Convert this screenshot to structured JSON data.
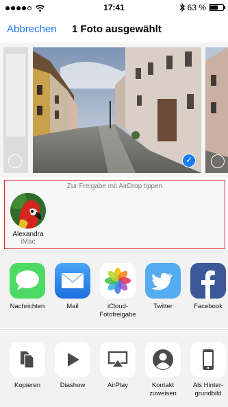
{
  "status_bar": {
    "time": "17:41",
    "battery_text": "63 %",
    "battery_level": 0.63,
    "signal_bars": 4
  },
  "nav": {
    "cancel_label": "Abbrechen",
    "title": "1 Foto ausgewählt"
  },
  "photos": {
    "selected_index": 1
  },
  "airdrop": {
    "hint": "Zur Freigabe mit AirDrop tippen",
    "contacts": [
      {
        "name": "Alexandra",
        "device": "iMac",
        "icon": "parrot-avatar"
      }
    ]
  },
  "share_apps": [
    {
      "label": "Nachrichten",
      "icon": "messages-icon"
    },
    {
      "label": "Mail",
      "icon": "mail-icon"
    },
    {
      "label": "iCloud-\nFotofreigabe",
      "icon": "photos-icon"
    },
    {
      "label": "Twitter",
      "icon": "twitter-icon"
    },
    {
      "label": "Facebook",
      "icon": "facebook-icon"
    }
  ],
  "actions": [
    {
      "label": "Kopieren",
      "icon": "copy-icon"
    },
    {
      "label": "Diashow",
      "icon": "play-icon"
    },
    {
      "label": "AirPlay",
      "icon": "airplay-icon"
    },
    {
      "label": "Kontakt\nzuweisen",
      "icon": "contact-icon"
    },
    {
      "label": "Als Hinter-\ngrundbild",
      "icon": "phone-icon"
    }
  ],
  "colors": {
    "accent": "#1b7cf5",
    "airdrop_border": "#d9262c",
    "messages": "#4cd964",
    "mail": "#2d8cf0",
    "twitter": "#55acee",
    "facebook": "#3b5998"
  }
}
